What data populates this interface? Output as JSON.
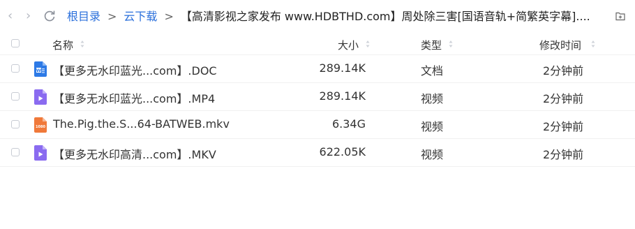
{
  "nav": {
    "back_icon": "chevron-left-icon",
    "forward_icon": "chevron-right-icon",
    "refresh_icon": "refresh-icon",
    "new_folder_icon": "new-folder-icon"
  },
  "breadcrumb": {
    "root": "根目录",
    "sep1": ">",
    "folder": "云下载",
    "sep2": ">",
    "current": "【高清影视之家发布 www.HDBTHD.com】周处除三害[国语音轨+简繁英字幕]...."
  },
  "columns": {
    "name": "名称",
    "size": "大小",
    "type": "类型",
    "modified": "修改时间"
  },
  "files": [
    {
      "name": "【更多无水印蓝光...com】.DOC",
      "size": "289.14K",
      "type": "文档",
      "time": "2分钟前",
      "icon": "doc-file-icon"
    },
    {
      "name": "【更多无水印蓝光...com】.MP4",
      "size": "289.14K",
      "type": "视频",
      "time": "2分钟前",
      "icon": "video-file-icon"
    },
    {
      "name": "The.Pig.the.S...64-BATWEB.mkv",
      "size": "6.34G",
      "type": "视频",
      "time": "2分钟前",
      "icon": "1080p-video-file-icon",
      "badge": "1080"
    },
    {
      "name": "【更多无水印高清...com】.MKV",
      "size": "622.05K",
      "type": "视频",
      "time": "2分钟前",
      "icon": "video-file-icon"
    }
  ],
  "colors": {
    "link": "#2a6fdb",
    "doc_icon": "#2d7ae6",
    "video_icon": "#8a6bf0",
    "hd_icon": "#f0793a"
  }
}
